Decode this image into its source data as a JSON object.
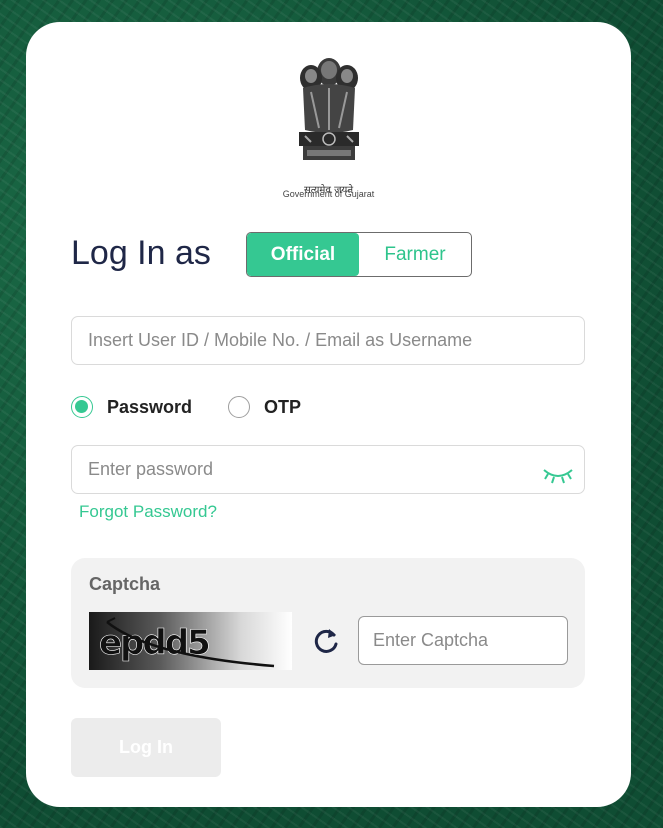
{
  "header": {
    "emblem_motto": "सत्यमेव जयते",
    "government_name": "Government of Gujarat"
  },
  "login": {
    "title": "Log In as",
    "user_types": [
      {
        "label": "Official",
        "active": true
      },
      {
        "label": "Farmer",
        "active": false
      }
    ]
  },
  "form": {
    "username_placeholder": "Insert User ID / Mobile No. / Email as Username",
    "auth_methods": [
      {
        "label": "Password",
        "checked": true
      },
      {
        "label": "OTP",
        "checked": false
      }
    ],
    "password_placeholder": "Enter password",
    "forgot_password": "Forgot Password?"
  },
  "captcha": {
    "label": "Captcha",
    "code": "epdd5",
    "input_placeholder": "Enter Captcha"
  },
  "submit": {
    "label": "Log In"
  },
  "colors": {
    "accent": "#35c892",
    "title": "#1f2747",
    "background": "#13573a"
  },
  "icons": {
    "password_visibility": "eye-closed-icon",
    "captcha_refresh": "refresh-icon"
  }
}
